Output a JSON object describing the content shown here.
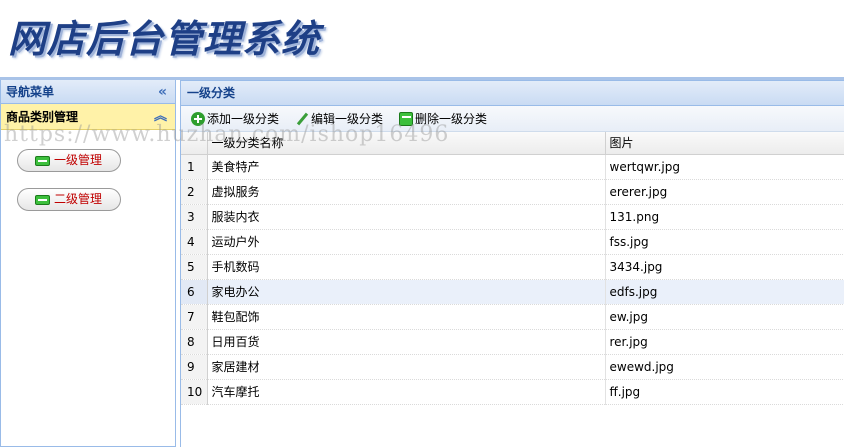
{
  "header": {
    "title": "网店后台管理系统"
  },
  "nav": {
    "title": "导航菜单",
    "collapse_glyph": "«",
    "category": {
      "title": "商品类别管理",
      "toggle_glyph": "︽"
    },
    "items": [
      {
        "label": "一级管理"
      },
      {
        "label": "二级管理"
      }
    ]
  },
  "main": {
    "title": "一级分类",
    "toolbar": {
      "add_label": "添加一级分类",
      "edit_label": "编辑一级分类",
      "delete_label": "删除一级分类"
    },
    "table": {
      "columns": [
        "一级分类名称",
        "图片"
      ],
      "rows": [
        {
          "num": "1",
          "name": "美食特产",
          "image": "wertqwr.jpg"
        },
        {
          "num": "2",
          "name": "虚拟服务",
          "image": "ererer.jpg"
        },
        {
          "num": "3",
          "name": "服装内衣",
          "image": "131.png"
        },
        {
          "num": "4",
          "name": "运动户外",
          "image": "fss.jpg"
        },
        {
          "num": "5",
          "name": "手机数码",
          "image": "3434.jpg"
        },
        {
          "num": "6",
          "name": "家电办公",
          "image": "edfs.jpg"
        },
        {
          "num": "7",
          "name": "鞋包配饰",
          "image": "ew.jpg"
        },
        {
          "num": "8",
          "name": "日用百货",
          "image": "rer.jpg"
        },
        {
          "num": "9",
          "name": "家居建材",
          "image": "ewewd.jpg"
        },
        {
          "num": "10",
          "name": "汽车摩托",
          "image": "ff.jpg"
        }
      ]
    }
  },
  "watermark": "https://www.huzhan.com/ishop16496",
  "colors": {
    "accent": "#15428b",
    "title": "#1e3f86",
    "nav_button_text": "#c00000",
    "category_bg": "#fff2a8"
  }
}
